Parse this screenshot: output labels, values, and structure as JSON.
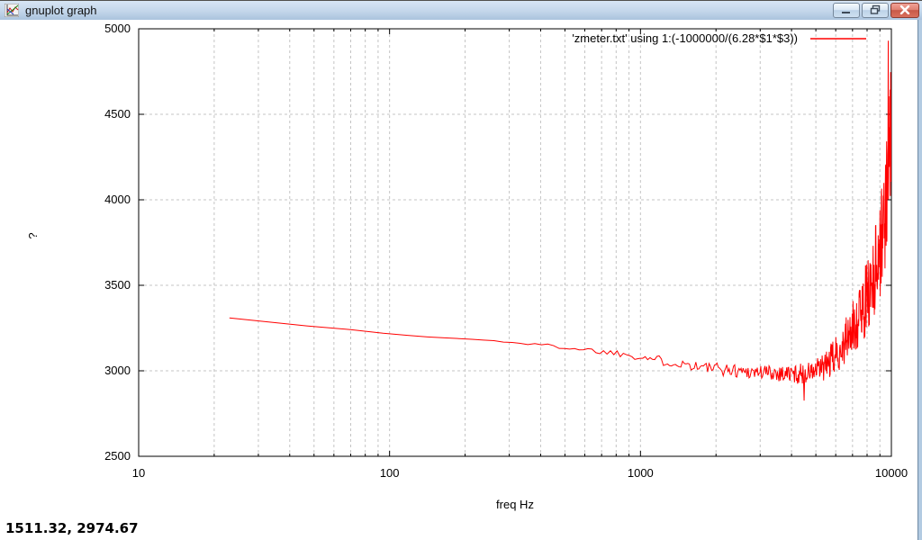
{
  "window": {
    "title": "gnuplot graph"
  },
  "titlebar": {
    "buttons": [
      {
        "name": "minimize",
        "icon": "minimize-icon"
      },
      {
        "name": "restore",
        "icon": "restore-icon"
      },
      {
        "name": "close",
        "icon": "close-icon"
      }
    ]
  },
  "status": {
    "coordinates": "1511.32, 2974.67"
  },
  "colors": {
    "series_red": "#ff0000",
    "grid": "#c4c4c4",
    "axis": "#000000",
    "titlebar_top": "#d7e5f4",
    "titlebar_bottom": "#aac3dd",
    "close_button": "#c85948"
  },
  "chart_data": {
    "type": "line",
    "title": "",
    "xlabel": "freq Hz",
    "ylabel": "?",
    "x_scale": "log",
    "xlim": [
      10,
      10000
    ],
    "ylim": [
      2500,
      5000
    ],
    "grid": true,
    "x_ticks": [
      {
        "value": 10,
        "label": "10"
      },
      {
        "value": 100,
        "label": "100"
      },
      {
        "value": 1000,
        "label": "1000"
      },
      {
        "value": 10000,
        "label": "10000"
      }
    ],
    "y_ticks": [
      {
        "value": 2500,
        "label": "2500"
      },
      {
        "value": 3000,
        "label": "3000"
      },
      {
        "value": 3500,
        "label": "3500"
      },
      {
        "value": 4000,
        "label": "4000"
      },
      {
        "value": 4500,
        "label": "4500"
      },
      {
        "value": 5000,
        "label": "5000"
      }
    ],
    "legend": {
      "position": "top-right",
      "entries": [
        {
          "label": "'zmeter.txt' using 1:(-1000000/(6.28*$1*$3))",
          "color": "#ff0000"
        }
      ]
    },
    "series": [
      {
        "name": "zmeter",
        "color": "#ff0000",
        "f_start": 23,
        "f_end": 10000,
        "samples": 420,
        "seed": 1337,
        "trend": [
          [
            23,
            3310
          ],
          [
            40,
            3272
          ],
          [
            70,
            3240
          ],
          [
            100,
            3215
          ],
          [
            150,
            3196
          ],
          [
            220,
            3183
          ],
          [
            300,
            3168
          ],
          [
            420,
            3148
          ],
          [
            500,
            3138
          ],
          [
            600,
            3125
          ],
          [
            700,
            3112
          ],
          [
            800,
            3105
          ],
          [
            900,
            3095
          ],
          [
            1000,
            3085
          ],
          [
            1200,
            3060
          ],
          [
            1500,
            3040
          ],
          [
            1800,
            3020
          ],
          [
            2200,
            3005
          ],
          [
            2800,
            2995
          ],
          [
            3500,
            2988
          ],
          [
            4200,
            2980
          ],
          [
            5000,
            2995
          ],
          [
            5500,
            3030
          ],
          [
            6000,
            3090
          ],
          [
            6500,
            3160
          ],
          [
            7000,
            3240
          ],
          [
            7500,
            3330
          ],
          [
            8000,
            3430
          ],
          [
            8500,
            3560
          ],
          [
            9000,
            3720
          ],
          [
            9400,
            3900
          ],
          [
            9700,
            4120
          ],
          [
            9900,
            4350
          ],
          [
            10000,
            4500
          ]
        ],
        "noise_amp": [
          [
            23,
            1
          ],
          [
            200,
            2
          ],
          [
            300,
            5
          ],
          [
            400,
            10
          ],
          [
            500,
            13
          ],
          [
            600,
            15
          ],
          [
            700,
            18
          ],
          [
            800,
            20
          ],
          [
            1000,
            25
          ],
          [
            1300,
            30
          ],
          [
            1700,
            33
          ],
          [
            2200,
            38
          ],
          [
            3000,
            45
          ],
          [
            4000,
            55
          ],
          [
            4800,
            65
          ],
          [
            5500,
            90
          ],
          [
            6000,
            110
          ],
          [
            6500,
            130
          ],
          [
            7000,
            160
          ],
          [
            7500,
            190
          ],
          [
            8000,
            220
          ],
          [
            8500,
            260
          ],
          [
            9000,
            300
          ],
          [
            9500,
            340
          ],
          [
            10000,
            370
          ]
        ],
        "spikes": [
          [
            4500,
            2826
          ],
          [
            9720,
            4930
          ]
        ]
      }
    ]
  }
}
